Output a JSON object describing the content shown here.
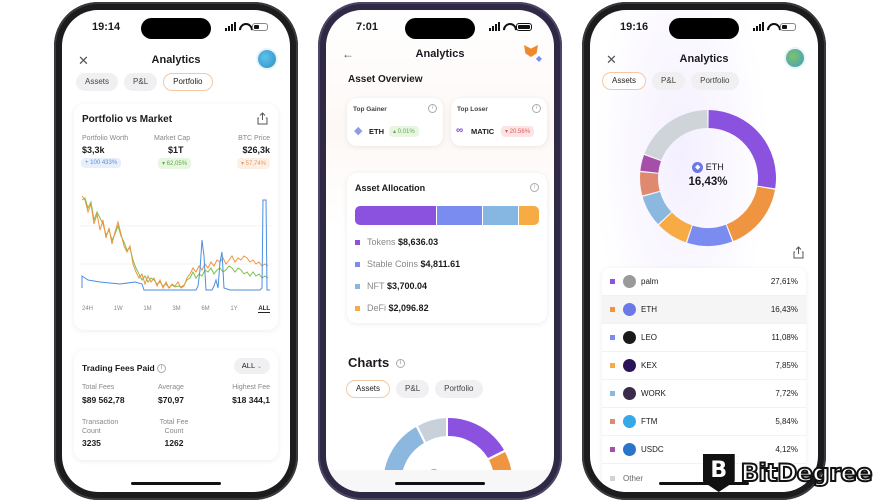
{
  "phone1": {
    "time": "19:14",
    "title": "Analytics",
    "tabs": [
      {
        "label": "Assets"
      },
      {
        "label": "P&L"
      },
      {
        "label": "Portfolio",
        "active": true
      }
    ],
    "portfolio_card": {
      "title": "Portfolio vs Market",
      "metrics": [
        {
          "label": "Portfolio Worth",
          "value": "$3,3k",
          "change": "+ 100 433%",
          "color": "#5b8fd9",
          "bg": "#e6effb"
        },
        {
          "label": "Market Cap",
          "value": "$1T",
          "change": "▾ 62,05%",
          "color": "#5fae4a",
          "bg": "#e7f5e1"
        },
        {
          "label": "BTC Price",
          "value": "$26,3k",
          "change": "▾ 57,74%",
          "color": "#e79a6a",
          "bg": "#fcefe4"
        }
      ],
      "ranges": [
        "24H",
        "1W",
        "1M",
        "3M",
        "6M",
        "1Y",
        "ALL"
      ],
      "active_range": "ALL"
    },
    "fees_card": {
      "title": "Trading Fees Paid",
      "filter": "ALL",
      "stats": [
        {
          "label": "Total Fees",
          "value": "$89 562,78"
        },
        {
          "label": "Average",
          "value": "$70,97"
        },
        {
          "label": "Highest Fee",
          "value": "$18 344,1"
        },
        {
          "label": "Transaction Count",
          "value": "3235"
        },
        {
          "label": "Total Fee Count",
          "value": "1262"
        }
      ]
    }
  },
  "phone2": {
    "time": "7:01",
    "title": "Analytics",
    "overview_title": "Asset Overview",
    "top_gainer": {
      "label": "Top Gainer",
      "coin": "ETH",
      "change": "▴ 0.01%"
    },
    "top_loser": {
      "label": "Top Loser",
      "coin": "MATIC",
      "change": "▾ 20.56%"
    },
    "allocation": {
      "title": "Asset Allocation",
      "items": [
        {
          "label": "Tokens",
          "value": "$8,636.03",
          "amount": 8636.03,
          "color": "#8b52e0"
        },
        {
          "label": "Stable Coins",
          "value": "$4,811.61",
          "amount": 4811.61,
          "color": "#7b8cf0"
        },
        {
          "label": "NFT",
          "value": "$3,700.04",
          "amount": 3700.04,
          "color": "#86b7e3"
        },
        {
          "label": "DeFi",
          "value": "$2,096.82",
          "amount": 2096.82,
          "color": "#f6ab45"
        }
      ]
    },
    "charts_title": "Charts",
    "chart_tabs": [
      {
        "label": "Assets",
        "active": true
      },
      {
        "label": "P&L"
      },
      {
        "label": "Portfolio"
      }
    ],
    "donut_center": "BTC"
  },
  "phone3": {
    "time": "19:16",
    "title": "Analytics",
    "tabs": [
      {
        "label": "Assets",
        "active": true
      },
      {
        "label": "P&L"
      },
      {
        "label": "Portfolio"
      }
    ],
    "donut_center": {
      "coin": "ETH",
      "value": "16,43%"
    },
    "assets": [
      {
        "name": "palm",
        "pct": "27,61%",
        "share": 27.61,
        "color": "#8b52e0",
        "coin_bg": "#9a9a9a"
      },
      {
        "name": "ETH",
        "pct": "16,43%",
        "share": 16.43,
        "color": "#ef9440",
        "coin_bg": "#6b79e8",
        "highlight": true
      },
      {
        "name": "LEO",
        "pct": "11,08%",
        "share": 11.08,
        "color": "#7b8cf0",
        "coin_bg": "#1a1a1a"
      },
      {
        "name": "KEX",
        "pct": "7,85%",
        "share": 7.85,
        "color": "#f6ab45",
        "coin_bg": "#2a1458"
      },
      {
        "name": "WORK",
        "pct": "7,72%",
        "share": 7.72,
        "color": "#8cb8e0",
        "coin_bg": "#3b2a4a"
      },
      {
        "name": "FTM",
        "pct": "5,84%",
        "share": 5.84,
        "color": "#df8a6e",
        "coin_bg": "#38a8e6"
      },
      {
        "name": "USDC",
        "pct": "4,12%",
        "share": 4.12,
        "color": "#a64fa8",
        "coin_bg": "#2a75c9"
      },
      {
        "name": "Other",
        "pct": "",
        "share": 19.35,
        "color": "#cfd4d9",
        "coin_bg": ""
      }
    ]
  },
  "brand": {
    "name": "BitDegree"
  }
}
